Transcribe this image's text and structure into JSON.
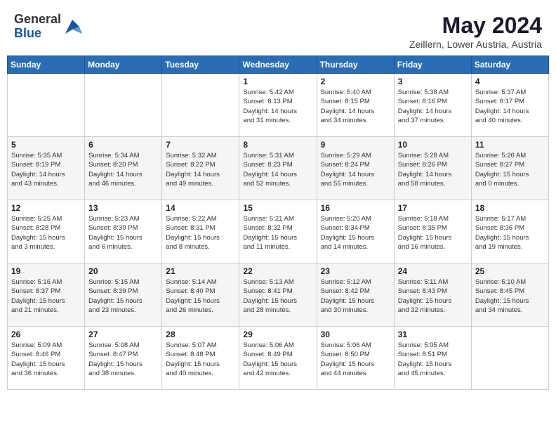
{
  "logo": {
    "general": "General",
    "blue": "Blue"
  },
  "title": "May 2024",
  "location": "Zeillern, Lower Austria, Austria",
  "weekdays": [
    "Sunday",
    "Monday",
    "Tuesday",
    "Wednesday",
    "Thursday",
    "Friday",
    "Saturday"
  ],
  "weeks": [
    [
      {
        "day": "",
        "info": ""
      },
      {
        "day": "",
        "info": ""
      },
      {
        "day": "",
        "info": ""
      },
      {
        "day": "1",
        "info": "Sunrise: 5:42 AM\nSunset: 8:13 PM\nDaylight: 14 hours\nand 31 minutes."
      },
      {
        "day": "2",
        "info": "Sunrise: 5:40 AM\nSunset: 8:15 PM\nDaylight: 14 hours\nand 34 minutes."
      },
      {
        "day": "3",
        "info": "Sunrise: 5:38 AM\nSunset: 8:16 PM\nDaylight: 14 hours\nand 37 minutes."
      },
      {
        "day": "4",
        "info": "Sunrise: 5:37 AM\nSunset: 8:17 PM\nDaylight: 14 hours\nand 40 minutes."
      }
    ],
    [
      {
        "day": "5",
        "info": "Sunrise: 5:35 AM\nSunset: 8:19 PM\nDaylight: 14 hours\nand 43 minutes."
      },
      {
        "day": "6",
        "info": "Sunrise: 5:34 AM\nSunset: 8:20 PM\nDaylight: 14 hours\nand 46 minutes."
      },
      {
        "day": "7",
        "info": "Sunrise: 5:32 AM\nSunset: 8:22 PM\nDaylight: 14 hours\nand 49 minutes."
      },
      {
        "day": "8",
        "info": "Sunrise: 5:31 AM\nSunset: 8:23 PM\nDaylight: 14 hours\nand 52 minutes."
      },
      {
        "day": "9",
        "info": "Sunrise: 5:29 AM\nSunset: 8:24 PM\nDaylight: 14 hours\nand 55 minutes."
      },
      {
        "day": "10",
        "info": "Sunrise: 5:28 AM\nSunset: 8:26 PM\nDaylight: 14 hours\nand 58 minutes."
      },
      {
        "day": "11",
        "info": "Sunrise: 5:26 AM\nSunset: 8:27 PM\nDaylight: 15 hours\nand 0 minutes."
      }
    ],
    [
      {
        "day": "12",
        "info": "Sunrise: 5:25 AM\nSunset: 8:28 PM\nDaylight: 15 hours\nand 3 minutes."
      },
      {
        "day": "13",
        "info": "Sunrise: 5:23 AM\nSunset: 8:30 PM\nDaylight: 15 hours\nand 6 minutes."
      },
      {
        "day": "14",
        "info": "Sunrise: 5:22 AM\nSunset: 8:31 PM\nDaylight: 15 hours\nand 8 minutes."
      },
      {
        "day": "15",
        "info": "Sunrise: 5:21 AM\nSunset: 8:32 PM\nDaylight: 15 hours\nand 11 minutes."
      },
      {
        "day": "16",
        "info": "Sunrise: 5:20 AM\nSunset: 8:34 PM\nDaylight: 15 hours\nand 14 minutes."
      },
      {
        "day": "17",
        "info": "Sunrise: 5:18 AM\nSunset: 8:35 PM\nDaylight: 15 hours\nand 16 minutes."
      },
      {
        "day": "18",
        "info": "Sunrise: 5:17 AM\nSunset: 8:36 PM\nDaylight: 15 hours\nand 19 minutes."
      }
    ],
    [
      {
        "day": "19",
        "info": "Sunrise: 5:16 AM\nSunset: 8:37 PM\nDaylight: 15 hours\nand 21 minutes."
      },
      {
        "day": "20",
        "info": "Sunrise: 5:15 AM\nSunset: 8:39 PM\nDaylight: 15 hours\nand 23 minutes."
      },
      {
        "day": "21",
        "info": "Sunrise: 5:14 AM\nSunset: 8:40 PM\nDaylight: 15 hours\nand 26 minutes."
      },
      {
        "day": "22",
        "info": "Sunrise: 5:13 AM\nSunset: 8:41 PM\nDaylight: 15 hours\nand 28 minutes."
      },
      {
        "day": "23",
        "info": "Sunrise: 5:12 AM\nSunset: 8:42 PM\nDaylight: 15 hours\nand 30 minutes."
      },
      {
        "day": "24",
        "info": "Sunrise: 5:11 AM\nSunset: 8:43 PM\nDaylight: 15 hours\nand 32 minutes."
      },
      {
        "day": "25",
        "info": "Sunrise: 5:10 AM\nSunset: 8:45 PM\nDaylight: 15 hours\nand 34 minutes."
      }
    ],
    [
      {
        "day": "26",
        "info": "Sunrise: 5:09 AM\nSunset: 8:46 PM\nDaylight: 15 hours\nand 36 minutes."
      },
      {
        "day": "27",
        "info": "Sunrise: 5:08 AM\nSunset: 8:47 PM\nDaylight: 15 hours\nand 38 minutes."
      },
      {
        "day": "28",
        "info": "Sunrise: 5:07 AM\nSunset: 8:48 PM\nDaylight: 15 hours\nand 40 minutes."
      },
      {
        "day": "29",
        "info": "Sunrise: 5:06 AM\nSunset: 8:49 PM\nDaylight: 15 hours\nand 42 minutes."
      },
      {
        "day": "30",
        "info": "Sunrise: 5:06 AM\nSunset: 8:50 PM\nDaylight: 15 hours\nand 44 minutes."
      },
      {
        "day": "31",
        "info": "Sunrise: 5:05 AM\nSunset: 8:51 PM\nDaylight: 15 hours\nand 45 minutes."
      },
      {
        "day": "",
        "info": ""
      }
    ]
  ]
}
